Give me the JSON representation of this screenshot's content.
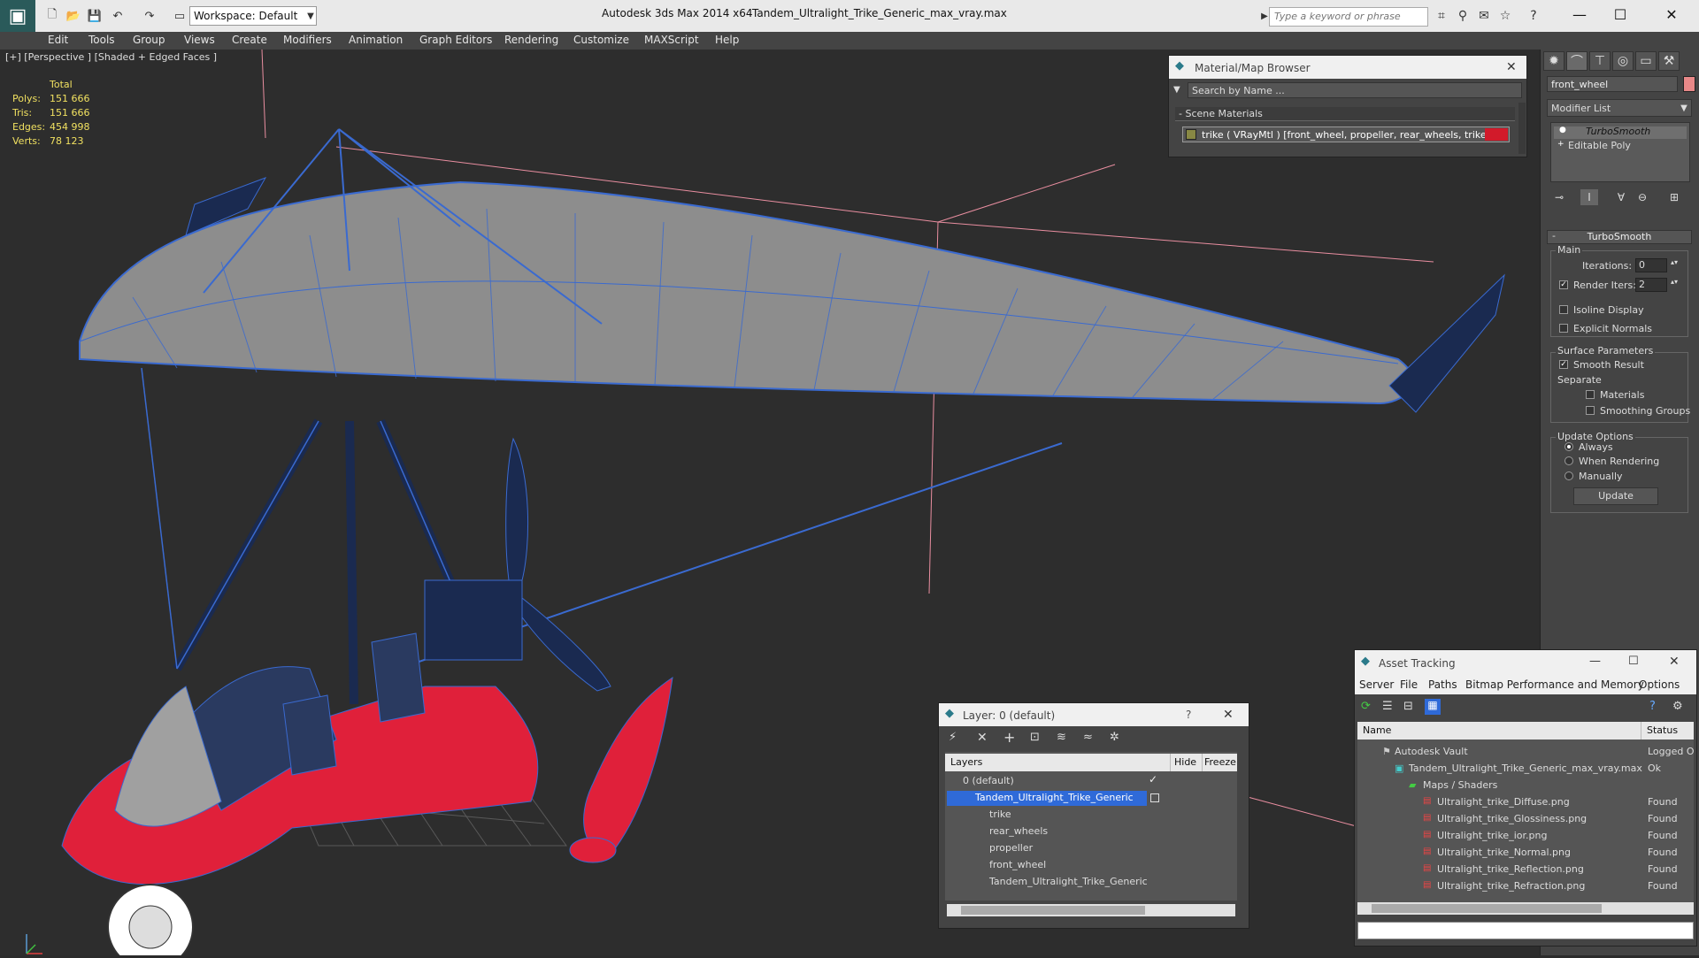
{
  "titlebar": {
    "workspace": "Workspace: Default",
    "app_title": "Autodesk 3ds Max  2014 x64",
    "doc_name": "Tandem_Ultralight_Trike_Generic_max_vray.max",
    "search_placeholder": "Type a keyword or phrase"
  },
  "menu": {
    "items": [
      "Edit",
      "Tools",
      "Group",
      "Views",
      "Create",
      "Modifiers",
      "Animation",
      "Graph Editors",
      "Rendering",
      "Customize",
      "MAXScript",
      "Help"
    ]
  },
  "viewport": {
    "label": "[+] [Perspective ] [Shaded + Edged Faces ]",
    "stats": {
      "total": "Total",
      "polys_label": "Polys:",
      "polys": "151 666",
      "tris_label": "Tris:",
      "tris": "151 666",
      "edges_label": "Edges:",
      "edges": "454 998",
      "verts_label": "Verts:",
      "verts": "78 123"
    }
  },
  "command_panel": {
    "object_name": "front_wheel",
    "object_color": "#e88888",
    "modifier_list": "Modifier List",
    "stack": [
      "TurboSmooth",
      "Editable Poly"
    ],
    "turbosmooth": {
      "title": "TurboSmooth",
      "main": "Main",
      "iterations_label": "Iterations:",
      "iterations": "0",
      "render_iters_label": "Render Iters:",
      "render_iters": "2",
      "isoline": "Isoline Display",
      "explicit_normals": "Explicit Normals",
      "surface_params": "Surface Parameters",
      "smooth_result": "Smooth Result",
      "separate": "Separate",
      "materials": "Materials",
      "smoothing_groups": "Smoothing Groups",
      "update_options": "Update Options",
      "always": "Always",
      "when_rendering": "When Rendering",
      "manually": "Manually",
      "update": "Update"
    }
  },
  "material_browser": {
    "title": "Material/Map Browser",
    "search": "Search by Name ...",
    "section": "- Scene Materials",
    "item": "trike  ( VRayMtl )  [front_wheel, propeller, rear_wheels, trike]"
  },
  "layer_dialog": {
    "title": "Layer: 0 (default)",
    "help": "?",
    "col_layers": "Layers",
    "col_hide": "Hide",
    "col_freeze": "Freeze",
    "rows": [
      "0 (default)",
      "Tandem_Ultralight_Trike_Generic",
      "trike",
      "rear_wheels",
      "propeller",
      "front_wheel",
      "Tandem_Ultralight_Trike_Generic"
    ]
  },
  "asset_tracking": {
    "title": "Asset Tracking",
    "menu": [
      "Server",
      "File",
      "Paths",
      "Bitmap Performance and Memory",
      "Options"
    ],
    "col_name": "Name",
    "col_status": "Status",
    "rows": [
      {
        "name": "Autodesk Vault",
        "status": "Logged O"
      },
      {
        "name": "Tandem_Ultralight_Trike_Generic_max_vray.max",
        "status": "Ok"
      },
      {
        "name": "Maps / Shaders",
        "status": ""
      },
      {
        "name": "Ultralight_trike_Diffuse.png",
        "status": "Found"
      },
      {
        "name": "Ultralight_trike_Glossiness.png",
        "status": "Found"
      },
      {
        "name": "Ultralight_trike_ior.png",
        "status": "Found"
      },
      {
        "name": "Ultralight_trike_Normal.png",
        "status": "Found"
      },
      {
        "name": "Ultralight_trike_Reflection.png",
        "status": "Found"
      },
      {
        "name": "Ultralight_trike_Refraction.png",
        "status": "Found"
      }
    ]
  }
}
